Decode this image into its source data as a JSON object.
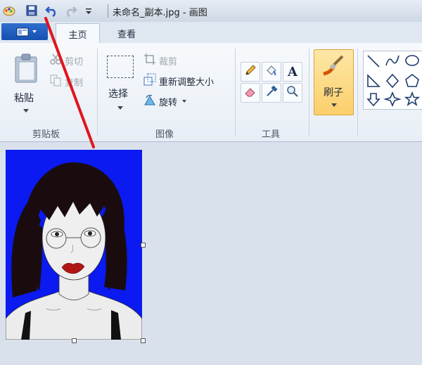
{
  "title": {
    "text": "未命名_副本.jpg - 画图"
  },
  "tabs": [
    {
      "label": "主页",
      "active": true
    },
    {
      "label": "查看",
      "active": false
    }
  ],
  "ribbon": {
    "clipboard": {
      "group_label": "剪贴板",
      "paste_label": "粘贴",
      "cut_label": "剪切",
      "copy_label": "复制"
    },
    "image": {
      "group_label": "图像",
      "select_label": "选择",
      "crop_label": "裁剪",
      "resize_label": "重新调整大小",
      "rotate_label": "旋转"
    },
    "tools": {
      "group_label": "工具",
      "items": [
        "pencil-icon",
        "fill-icon",
        "text-icon",
        "eraser-icon",
        "color-picker-icon",
        "magnifier-icon"
      ],
      "text_glyph": "A"
    },
    "brushes": {
      "label": "刷子"
    },
    "shapes": {
      "items": [
        "line-icon",
        "curve-icon",
        "oval-icon",
        "triangle-icon",
        "diamond-icon",
        "pentagon-icon",
        "arrow-icon",
        "star4-icon",
        "star5-icon"
      ]
    }
  },
  "colors": {
    "canvas_bg": "#0a1af0",
    "annotation": "#e1141c",
    "file_button": "#1f5fc8"
  }
}
